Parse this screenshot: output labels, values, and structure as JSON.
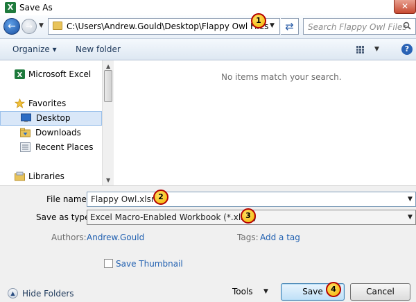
{
  "window": {
    "title": "Save As",
    "app_icon_glyph": "X",
    "close_glyph": "✕"
  },
  "addressbar": {
    "path": "C:\\Users\\Andrew.Gould\\Desktop\\Flappy Owl Files",
    "search_placeholder": "Search Flappy Owl Files"
  },
  "toolbar": {
    "organize_label": "Organize ▾",
    "new_folder_label": "New folder",
    "help_glyph": "?"
  },
  "nav": {
    "items": [
      {
        "label": "Microsoft Excel",
        "icon": "excel-icon",
        "group": true,
        "selected": false
      },
      {
        "label": "Favorites",
        "icon": "star-icon",
        "group": true,
        "selected": false
      },
      {
        "label": "Desktop",
        "icon": "desktop-icon",
        "group": false,
        "selected": true
      },
      {
        "label": "Downloads",
        "icon": "downloads-folder-icon",
        "group": false,
        "selected": false
      },
      {
        "label": "Recent Places",
        "icon": "recent-places-icon",
        "group": false,
        "selected": false
      },
      {
        "label": "Libraries",
        "icon": "libraries-icon",
        "group": true,
        "selected": false
      }
    ]
  },
  "content": {
    "empty_message": "No items match your search."
  },
  "form": {
    "filename_label": "File name:",
    "filename_value": "Flappy Owl.xlsm",
    "savetype_label": "Save as type:",
    "savetype_value": "Excel Macro-Enabled Workbook (*.xlsm)",
    "authors_label": "Authors:",
    "authors_value": "Andrew.Gould",
    "tags_label": "Tags:",
    "tags_value": "Add a tag",
    "thumbnail_label": "Save Thumbnail",
    "thumbnail_checked": false
  },
  "footer": {
    "hide_folders_label": "Hide Folders",
    "tools_label": "Tools",
    "save_label": "Save",
    "cancel_label": "Cancel"
  },
  "markers": [
    "1",
    "2",
    "3",
    "4"
  ],
  "colors": {
    "selection": "#d9e7f8",
    "link": "#1f5fb0",
    "marker_fill": "#f2b500",
    "marker_border": "#b40000"
  }
}
